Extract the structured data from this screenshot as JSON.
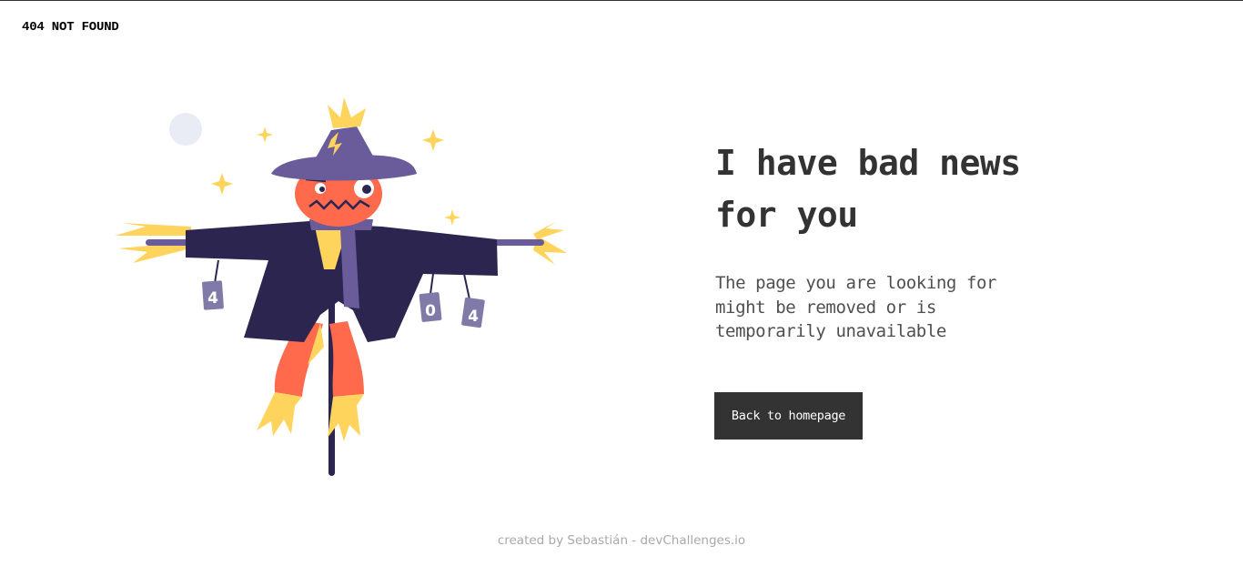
{
  "header": {
    "title": "404 NOT FOUND"
  },
  "main": {
    "headline": "I have bad news for you",
    "message": "The page you are looking for might be removed or is temporarily unavailable",
    "back_button_label": "Back to homepage"
  },
  "illustration": {
    "subject": "scarecrow",
    "can_digits": [
      "4",
      "0",
      "4"
    ],
    "colors": {
      "coat": "#2b2550",
      "hat": "#6a5b9a",
      "face": "#ff6a4d",
      "straw": "#ffd45c",
      "moon": "#e9ecf5",
      "cans": "#807aa8"
    }
  },
  "footer": {
    "credit": "created by Sebastián - devChallenges.io"
  },
  "colors": {
    "button_bg": "#333333",
    "button_text": "#ffffff",
    "text_primary": "#333333",
    "text_muted": "#a9a9a9"
  }
}
